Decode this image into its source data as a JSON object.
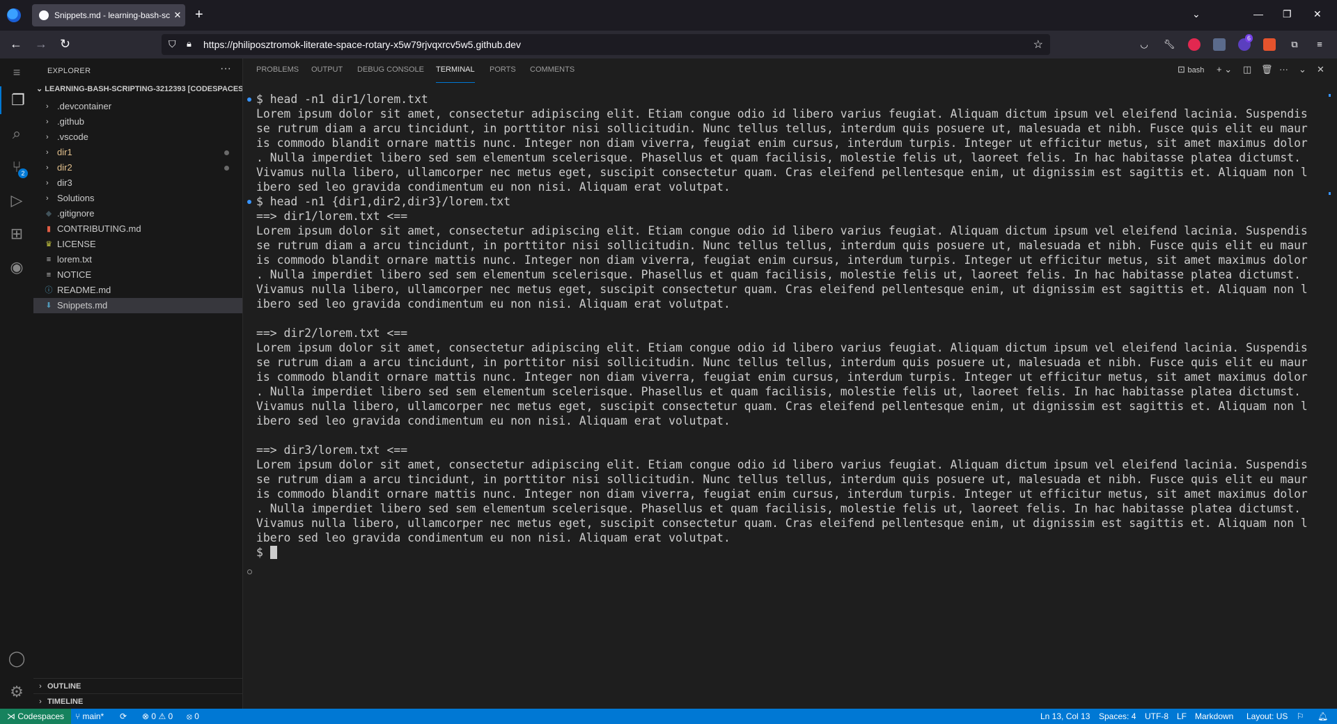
{
  "browser": {
    "tab_title": "Snippets.md - learning-bash-sc",
    "url": "https://philiposztromok-literate-space-rotary-x5w79rjvqxrcv5w5.github.dev",
    "ext_badge": "6"
  },
  "explorer": {
    "title": "EXPLORER",
    "root": "LEARNING-BASH-SCRIPTING-3212393 [CODESPACES]",
    "items": [
      {
        "label": ".devcontainer",
        "type": "folder"
      },
      {
        "label": ".github",
        "type": "folder"
      },
      {
        "label": ".vscode",
        "type": "folder"
      },
      {
        "label": "dir1",
        "type": "folder",
        "modified": true
      },
      {
        "label": "dir2",
        "type": "folder",
        "modified": true
      },
      {
        "label": "dir3",
        "type": "folder"
      },
      {
        "label": "Solutions",
        "type": "folder"
      },
      {
        "label": ".gitignore",
        "type": "file",
        "icon": "git-icon"
      },
      {
        "label": "CONTRIBUTING.md",
        "type": "file",
        "icon": "contributing-icon"
      },
      {
        "label": "LICENSE",
        "type": "file",
        "icon": "license-icon"
      },
      {
        "label": "lorem.txt",
        "type": "file",
        "icon": "text-file-icon"
      },
      {
        "label": "NOTICE",
        "type": "file",
        "icon": "text-file-icon"
      },
      {
        "label": "README.md",
        "type": "file",
        "icon": "info-icon"
      },
      {
        "label": "Snippets.md",
        "type": "file",
        "icon": "markdown-icon",
        "selected": true
      }
    ],
    "outline": "OUTLINE",
    "timeline": "TIMELINE",
    "scm_badge": "2"
  },
  "panel": {
    "tabs": [
      "PROBLEMS",
      "OUTPUT",
      "DEBUG CONSOLE",
      "TERMINAL",
      "PORTS",
      "COMMENTS"
    ],
    "active_tab": "TERMINAL",
    "shell": "bash"
  },
  "terminal": {
    "cmd1": "$ head -n1 dir1/lorem.txt",
    "cmd2": "$ head -n1 {dir1,dir2,dir3}/lorem.txt",
    "hdr1": "==> dir1/lorem.txt <==",
    "hdr2": "==> dir2/lorem.txt <==",
    "hdr3": "==> dir3/lorem.txt <==",
    "lorem": [
      "Lorem ipsum dolor sit amet, consectetur adipiscing elit. Etiam congue odio id libero varius feugiat. Aliquam dictum ipsum vel eleifend lacinia. Suspendis",
      "se rutrum diam a arcu tincidunt, in porttitor nisi sollicitudin. Nunc tellus tellus, interdum quis posuere ut, malesuada et nibh. Fusce quis elit eu maur",
      "is commodo blandit ornare mattis nunc. Integer non diam viverra, feugiat enim cursus, interdum turpis. Integer ut efficitur metus, sit amet maximus dolor",
      ". Nulla imperdiet libero sed sem elementum scelerisque. Phasellus et quam facilisis, molestie felis ut, laoreet felis. In hac habitasse platea dictumst.",
      "Vivamus nulla libero, ullamcorper nec metus eget, suscipit consectetur quam. Cras eleifend pellentesque enim, ut dignissim est sagittis et. Aliquam non l",
      "ibero sed leo gravida condimentum eu non nisi. Aliquam erat volutpat."
    ],
    "prompt": "$ "
  },
  "status": {
    "remote": "Codespaces",
    "branch": "main*",
    "problems": "0",
    "warnings": "0",
    "ports": "0",
    "position": "Ln 13, Col 13",
    "spaces": "Spaces: 4",
    "encoding": "UTF-8",
    "eol": "LF",
    "language": "Markdown",
    "layout": "Layout: US"
  }
}
